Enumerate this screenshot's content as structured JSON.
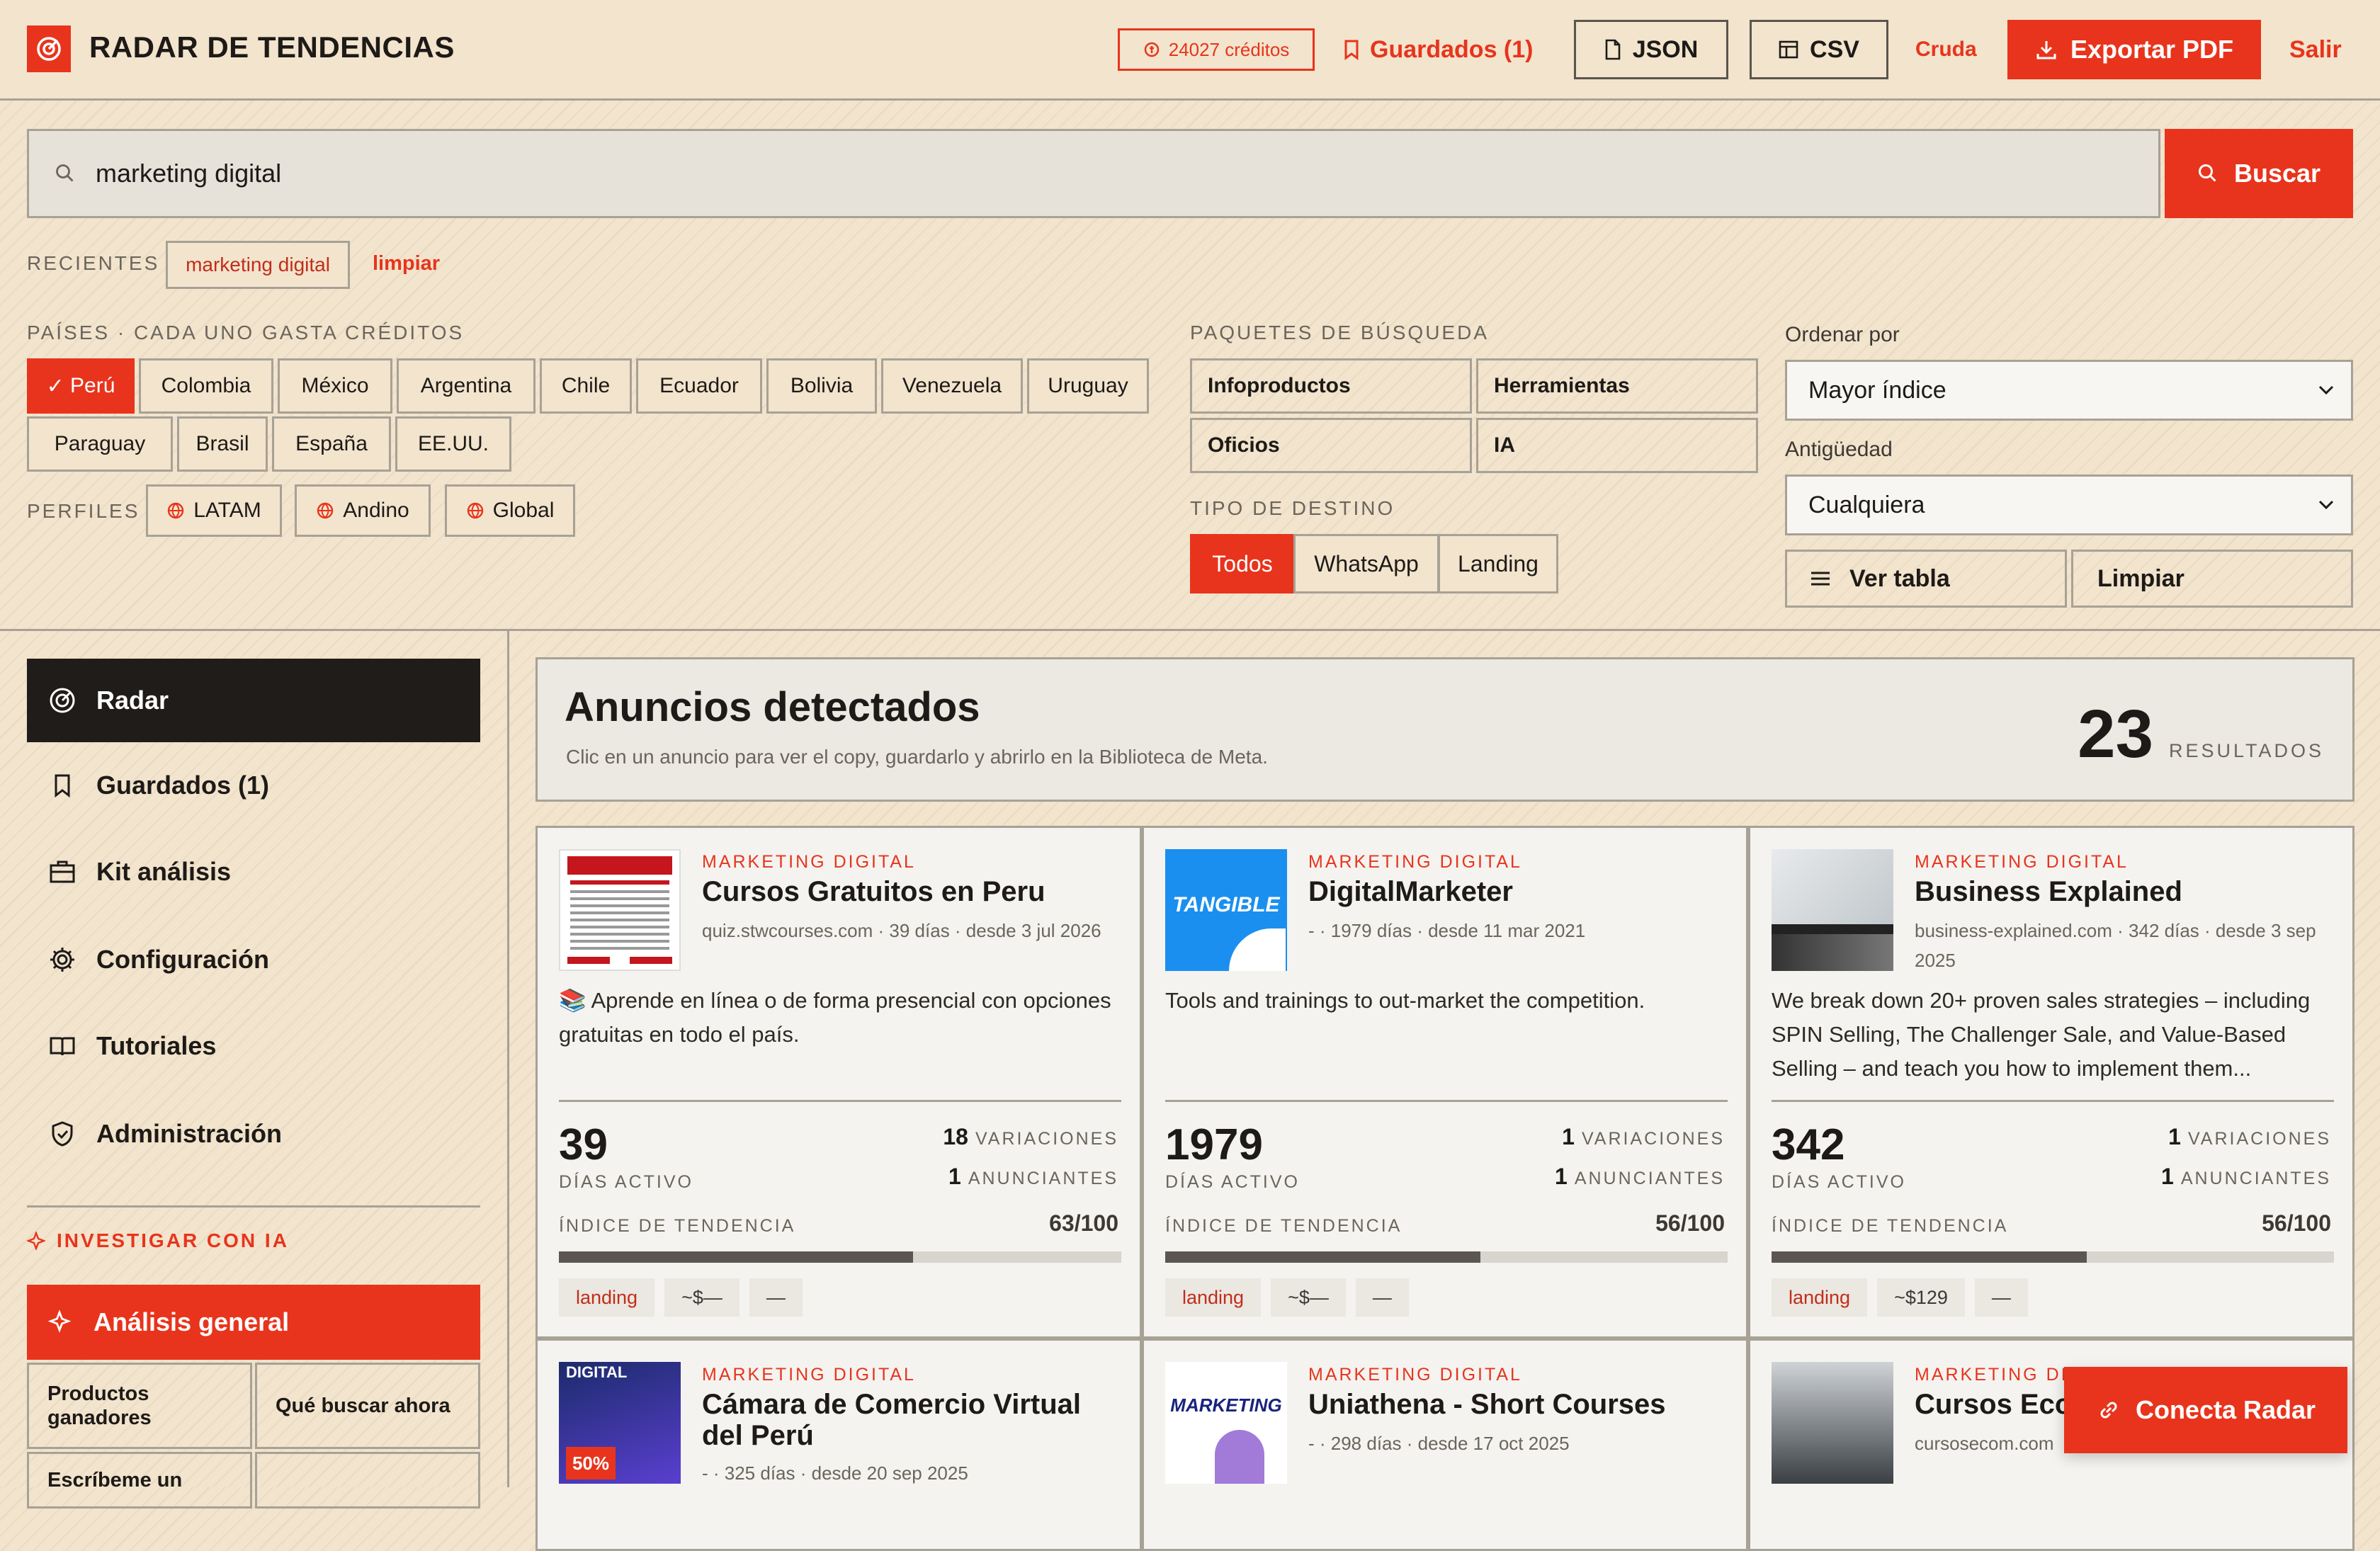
{
  "header": {
    "brand": "RADAR DE TENDENCIAS",
    "credits": "24027 créditos",
    "saved": "Guardados (1)",
    "json": "JSON",
    "csv": "CSV",
    "cruda": "Cruda",
    "export": "Exportar PDF",
    "logout": "Salir"
  },
  "search": {
    "value": "marketing digital",
    "button": "Buscar",
    "recent_label": "RECIENTES",
    "recent": [
      "marketing digital"
    ],
    "clear": "limpiar"
  },
  "filters": {
    "countries_label": "PAÍSES · CADA UNO GASTA CRÉDITOS",
    "countries": [
      "Perú",
      "Colombia",
      "México",
      "Argentina",
      "Chile",
      "Ecuador",
      "Bolivia",
      "Venezuela",
      "Uruguay",
      "Paraguay",
      "Brasil",
      "España",
      "EE.UU."
    ],
    "country_selected": "Perú",
    "profiles_label": "PERFILES",
    "profiles": [
      "LATAM",
      "Andino",
      "Global"
    ],
    "packages_label": "PAQUETES DE BÚSQUEDA",
    "packages": [
      "Infoproductos",
      "Herramientas",
      "Oficios",
      "IA"
    ],
    "dest_label": "TIPO DE DESTINO",
    "destinations": [
      "Todos",
      "WhatsApp",
      "Landing"
    ],
    "dest_selected": "Todos",
    "sort_label": "Ordenar por",
    "sort_value": "Mayor índice",
    "age_label": "Antigüedad",
    "age_value": "Cualquiera",
    "table_btn": "Ver tabla",
    "clear_btn": "Limpiar"
  },
  "sidebar": {
    "items": [
      {
        "label": "Radar",
        "icon": "radar-icon",
        "active": true
      },
      {
        "label": "Guardados (1)",
        "icon": "bookmark-icon"
      },
      {
        "label": "Kit análisis",
        "icon": "briefcase-icon"
      },
      {
        "label": "Configuración",
        "icon": "gear-icon"
      },
      {
        "label": "Tutoriales",
        "icon": "book-icon"
      },
      {
        "label": "Administración",
        "icon": "shield-icon"
      }
    ],
    "ai_label": "INVESTIGAR CON IA",
    "ai_main": "Análisis general",
    "ai_grid": [
      "Productos ganadores",
      "Qué buscar ahora",
      "Escríbeme un"
    ]
  },
  "results": {
    "title": "Anuncios detectados",
    "subtitle": "Clic en un anuncio para ver el copy, guardarlo y abrirlo en la Biblioteca de Meta.",
    "count": "23",
    "count_label": "RESULTADOS"
  },
  "cards": [
    {
      "category": "MARKETING DIGITAL",
      "title": "Cursos Gratuitos en Peru",
      "meta": "quiz.stwcourses.com · 39 días · desde 3 jul 2026",
      "copy": "📚 Aprende en línea o de forma presencial con opciones gratuitas en todo el país.",
      "days": "39",
      "days_label": "DÍAS ACTIVO",
      "variations": "18",
      "variations_label": "VARIACIONES",
      "advertisers": "1",
      "advertisers_label": "ANUNCIANTES",
      "index_label": "ÍNDICE DE TENDENCIA",
      "index": "63/100",
      "index_value": 63,
      "tags": [
        "landing",
        "~$—",
        "—"
      ]
    },
    {
      "category": "MARKETING DIGITAL",
      "title": "DigitalMarketer",
      "meta": "- · 1979 días · desde 11 mar 2021",
      "copy": "Tools and trainings to out-market the competition.",
      "days": "1979",
      "days_label": "DÍAS ACTIVO",
      "variations": "1",
      "variations_label": "VARIACIONES",
      "advertisers": "1",
      "advertisers_label": "ANUNCIANTES",
      "index_label": "ÍNDICE DE TENDENCIA",
      "index": "56/100",
      "index_value": 56,
      "tags": [
        "landing",
        "~$—",
        "—"
      ],
      "thumb_text": "TANGIBLE"
    },
    {
      "category": "MARKETING DIGITAL",
      "title": "Business Explained",
      "meta": "business-explained.com · 342 días · desde 3 sep 2025",
      "copy": "We break down 20+ proven sales strategies – including SPIN Selling, The Challenger Sale, and Value-Based Selling – and teach you how to implement them...",
      "days": "342",
      "days_label": "DÍAS ACTIVO",
      "variations": "1",
      "variations_label": "VARIACIONES",
      "advertisers": "1",
      "advertisers_label": "ANUNCIANTES",
      "index_label": "ÍNDICE DE TENDENCIA",
      "index": "56/100",
      "index_value": 56,
      "tags": [
        "landing",
        "~$129",
        "—"
      ]
    },
    {
      "category": "MARKETING DIGITAL",
      "title": "Cámara de Comercio Virtual del Perú",
      "meta": "- · 325 días · desde 20 sep 2025",
      "thumb_text": "DIGITAL",
      "thumb_badge": "50%"
    },
    {
      "category": "MARKETING DIGITAL",
      "title": "Uniathena - Short Courses",
      "meta": "- · 298 días · desde 17 oct 2025",
      "thumb_text": "MARKETING"
    },
    {
      "category": "MARKETING DIG",
      "title": "Cursos Eco",
      "meta": "cursosecom.com"
    }
  ],
  "cta": "Conecta Radar",
  "colors": {
    "accent": "#e8341c",
    "dark": "#1f1c19",
    "bg": "#f2e4cd"
  }
}
